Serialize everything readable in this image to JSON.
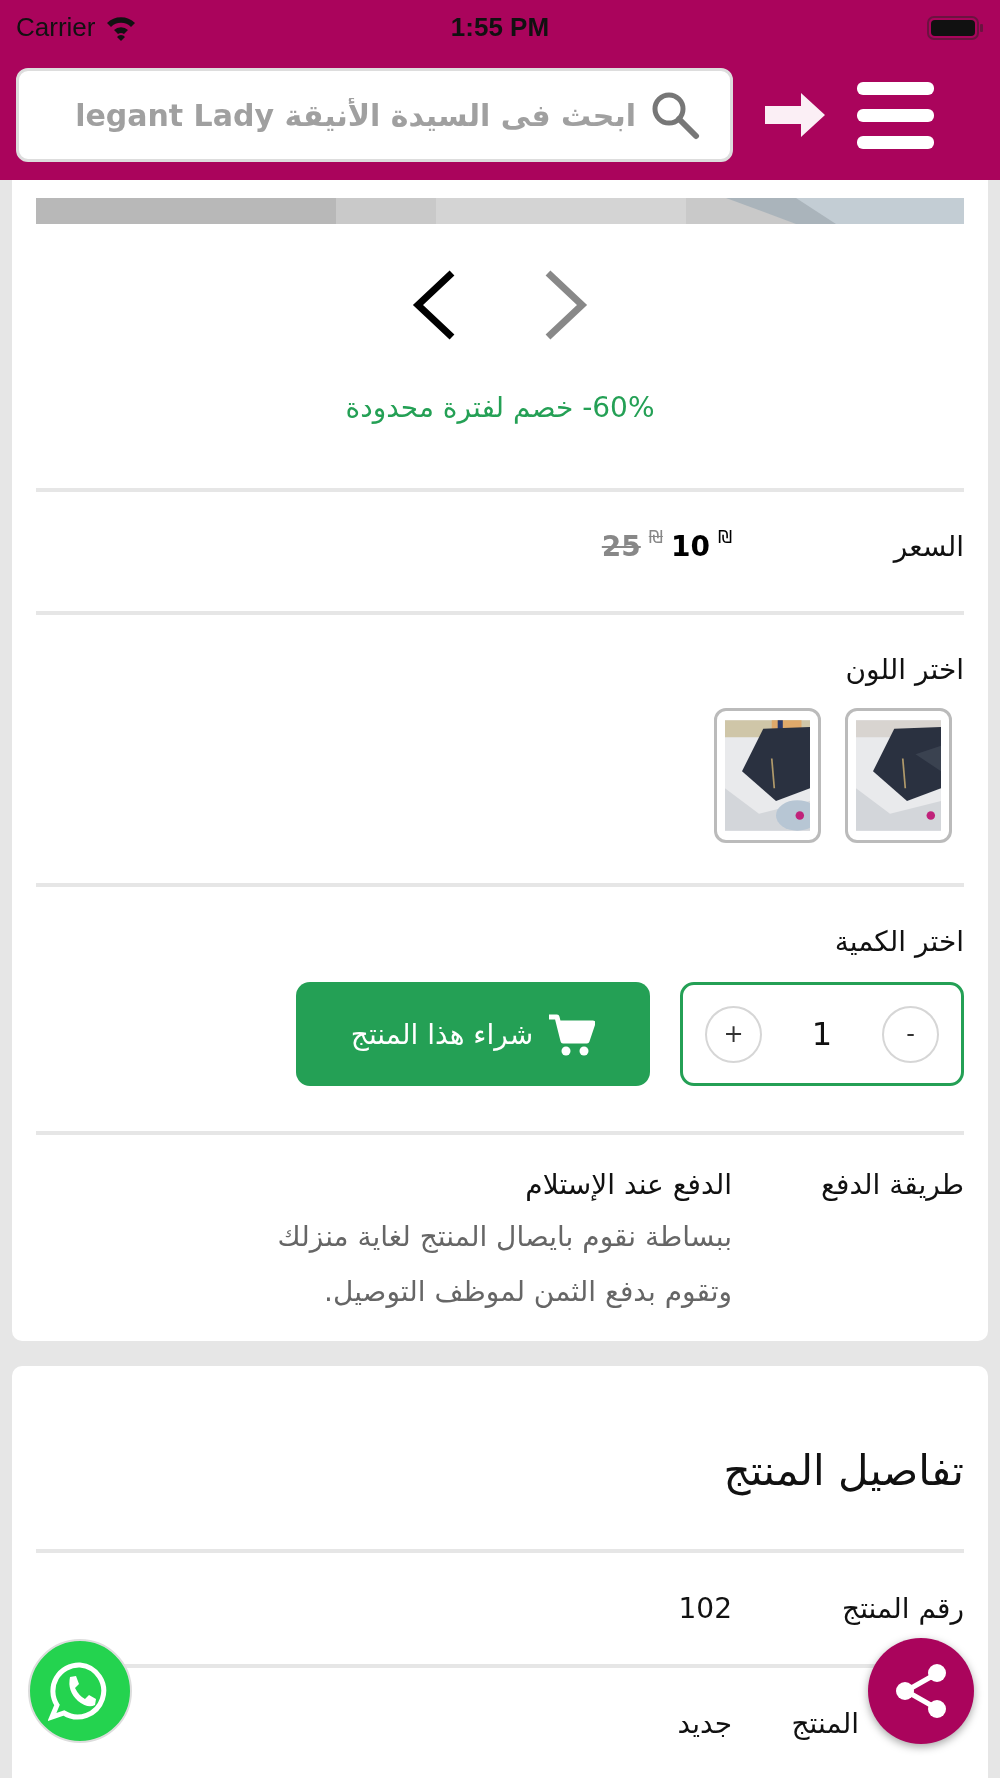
{
  "status_bar": {
    "carrier": "Carrier",
    "time": "1:55 PM"
  },
  "header": {
    "search": {
      "placeholder": "ابحث فى السيدة الأنيقة legant Lady"
    }
  },
  "gallery": {
    "kind": "picture",
    "arrows": [
      {
        "kind": "previous",
        "disabled": false
      },
      {
        "kind": "next",
        "disabled": true
      }
    ]
  },
  "discount": "60%- خصم لفترة محدودة",
  "price": {
    "label": "السعر",
    "currency": "₪",
    "amount": "10",
    "old_currency": "₪",
    "old_amount": "25"
  },
  "color_picker": {
    "label": "اختر اللون"
  },
  "quantity": {
    "label": "اختر الكمية",
    "decrement": "-",
    "value": "1",
    "increment": "+",
    "buy_button": "شراء هذا المنتج"
  },
  "payment": {
    "label": "طريقة الدفع",
    "method": "الدفع عند الإستلام",
    "description": "ببساطة نقوم بايصال المنتج لغاية منزلك وتقوم بدفع الثمن لموظف التوصيل."
  },
  "details": {
    "title": "تفاصيل المنتج",
    "rows": [
      {
        "label": "رقم المنتج",
        "value": "102",
        "kind": "plain"
      },
      {
        "label": "المنتج",
        "value": "جديد",
        "kind": "covered"
      }
    ]
  }
}
